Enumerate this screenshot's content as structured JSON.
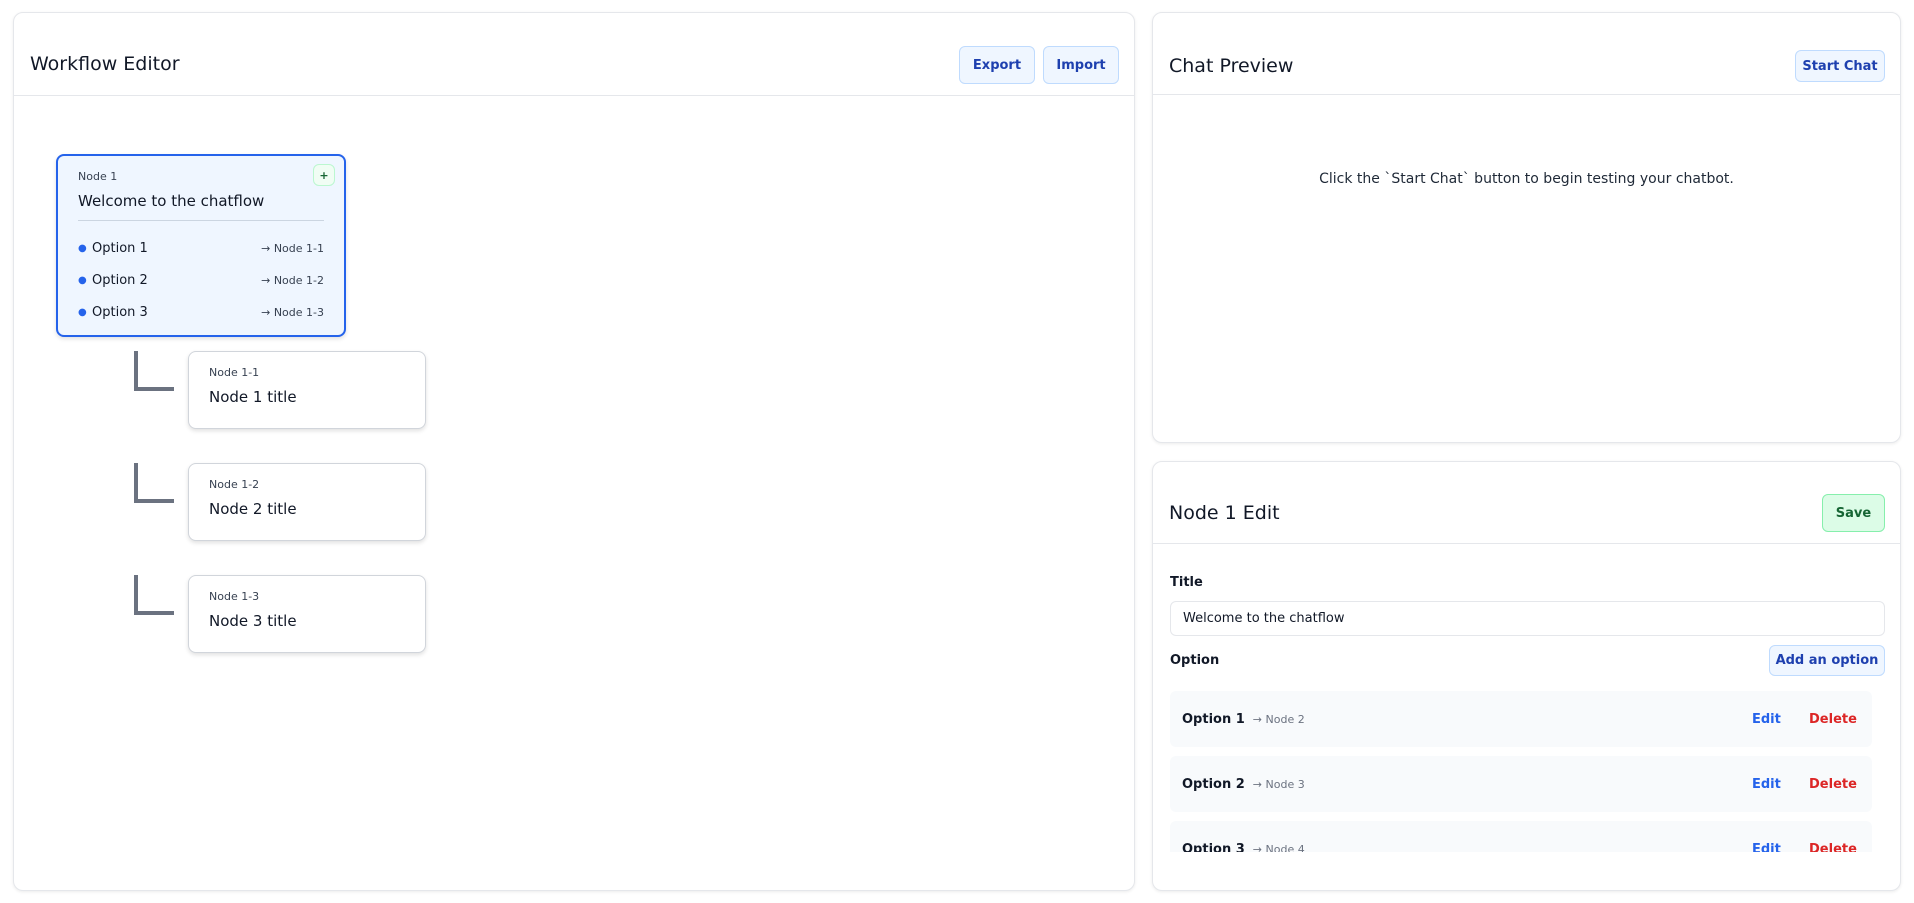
{
  "workflow": {
    "title": "Workflow Editor",
    "export_label": "Export",
    "import_label": "Import",
    "main_node": {
      "id": "Node 1",
      "title": "Welcome to the chatflow",
      "add_label": "+",
      "options": [
        {
          "label": "Option 1",
          "target": "→ Node 1-1"
        },
        {
          "label": "Option 2",
          "target": "→ Node 1-2"
        },
        {
          "label": "Option 3",
          "target": "→ Node 1-3"
        }
      ]
    },
    "children": [
      {
        "id": "Node 1-1",
        "title": "Node 1 title"
      },
      {
        "id": "Node 1-2",
        "title": "Node 2 title"
      },
      {
        "id": "Node 1-3",
        "title": "Node 3 title"
      }
    ]
  },
  "chat": {
    "title": "Chat Preview",
    "start_label": "Start Chat",
    "hint": "Click the `Start Chat` button to begin testing your chatbot."
  },
  "edit": {
    "title": "Node 1 Edit",
    "save_label": "Save",
    "title_label": "Title",
    "title_value": "Welcome to the chatflow",
    "option_label": "Option",
    "add_option_label": "Add an option",
    "options": [
      {
        "label": "Option 1",
        "target": "→ Node 2",
        "edit": "Edit",
        "delete": "Delete"
      },
      {
        "label": "Option 2",
        "target": "→ Node 3",
        "edit": "Edit",
        "delete": "Delete"
      },
      {
        "label": "Option 3",
        "target": "→ Node 4",
        "edit": "Edit",
        "delete": "Delete"
      }
    ]
  },
  "colors": {
    "accent": "#2563eb",
    "danger": "#dc2626",
    "success": "#166534"
  }
}
